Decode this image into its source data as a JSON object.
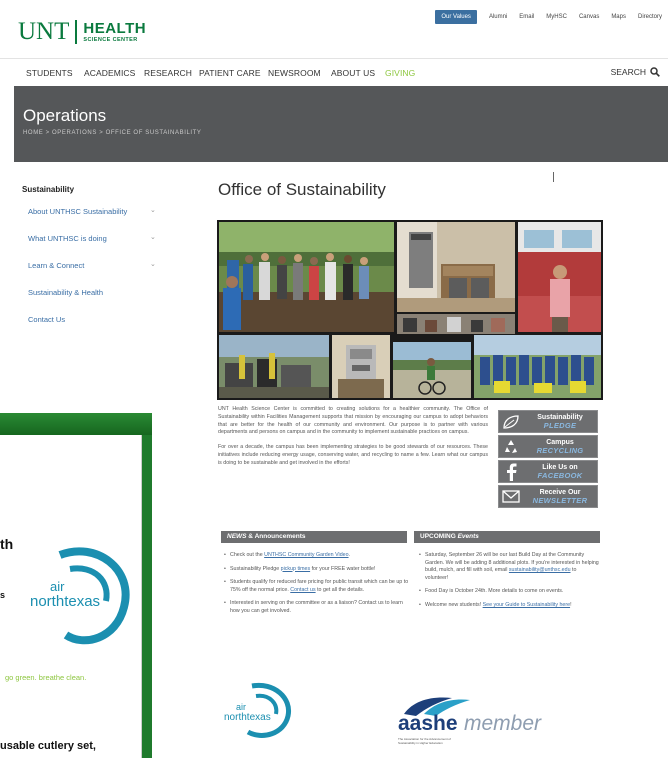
{
  "header": {
    "logo_unt": "UNT",
    "logo_health": "HEALTH",
    "logo_sub": "SCIENCE CENTER",
    "utility_links": [
      "Our Values",
      "Alumni",
      "Email",
      "MyHSC",
      "Canvas",
      "Maps",
      "Directory"
    ]
  },
  "nav": {
    "items": [
      "STUDENTS",
      "ACADEMICS",
      "RESEARCH",
      "PATIENT CARE",
      "NEWSROOM",
      "ABOUT US",
      "GIVING"
    ],
    "search_label": "SEARCH"
  },
  "banner": {
    "title": "Operations",
    "breadcrumb": "HOME  >  OPERATIONS  >  OFFICE OF SUSTAINABILITY"
  },
  "sidebar": {
    "title": "Sustainability",
    "items": [
      {
        "label": "About UNTHSC Sustainability",
        "expandable": true
      },
      {
        "label": "What UNTHSC is doing",
        "expandable": true
      },
      {
        "label": "Learn & Connect",
        "expandable": true
      },
      {
        "label": "Sustainability & Health",
        "expandable": false
      },
      {
        "label": "Contact Us",
        "expandable": false
      }
    ]
  },
  "content": {
    "title": "Office of Sustainability",
    "paragraph1": "UNT Health Science Center is committed to creating solutions for a healthier community. The Office of Sustainability within Facilities Management supports that mission by encouraging our campus to adopt behaviors that are better for the health of our community and environment. Our purpose is to partner with various departments and persons on campus and in the community to implement sustainable practices on campus.",
    "paragraph2": "For over a decade, the campus has been implementing strategies to be good stewards of our resources. These initiatives include reducing energy usage, conserving water, and recycling to name a few. Learn what our campus is doing to be sustainable and get involved in the efforts!"
  },
  "badges": [
    {
      "line1": "Sustainability",
      "line2": "PLEDGE",
      "icon": "leaf-icon"
    },
    {
      "line1": "Campus",
      "line2": "RECYCLING",
      "icon": "recycle-icon"
    },
    {
      "line1": "Like Us on",
      "line2": "FACEBOOK",
      "icon": "facebook-icon"
    },
    {
      "line1": "Receive Our",
      "line2": "NEWSLETTER",
      "icon": "envelope-icon"
    }
  ],
  "news": {
    "heading_em": "NEWS",
    "heading_rest": " & Announcements",
    "items": [
      {
        "pre": "Check out the ",
        "link": "UNTHSC Community Garden Video",
        "post": "."
      },
      {
        "pre": "Sustainability Pledge ",
        "link": "pickup times",
        "post": " for your FREE water bottle!"
      },
      {
        "pre": "Students qualify for reduced fare pricing for public transit which can be up to 75% off the normal price. ",
        "link": "Contact us",
        "post": " to get all the details."
      },
      {
        "pre": "Interested in serving on the committee or as a liaison? Contact us to learn how you can get involved.",
        "link": "",
        "post": ""
      }
    ]
  },
  "events": {
    "heading_rest": "UPCOMING ",
    "heading_em": "Events",
    "items": [
      {
        "pre": "Saturday, September 26 will be our last Build Day at the Community Garden. We will be adding 8 additional plots. If you're interested in helping build, mulch, and fill with soil, email ",
        "link": "sustainability@unthsc.edu",
        "post": " to volunteer!"
      },
      {
        "pre": "Food Day is October 24th. More details to come on events.",
        "link": "",
        "post": ""
      },
      {
        "pre": "Welcome new students! ",
        "link": "See your Guide to Sustainability here",
        "post": "!"
      }
    ]
  },
  "footer_logos": {
    "air_word": "air",
    "air_brand": "northtexas",
    "aashe_word": "aashe",
    "aashe_member": "member",
    "aashe_sub": "The Association for the Advancement of Sustainability in Higher Education"
  },
  "overlay": {
    "partial_heading": "th",
    "partial_letter": "s",
    "air_word": "air",
    "air_brand": "northtexas",
    "tagline": "go green. breathe clean.",
    "cutlery_text": "usable cutlery set,"
  },
  "colors": {
    "brand_green": "#0a7a3e",
    "giving_green": "#8dc63f",
    "banner_gray": "#555759",
    "link_blue": "#3a6ea5",
    "air_teal": "#1b8fb0",
    "overlay_green": "#1f7a2c"
  }
}
